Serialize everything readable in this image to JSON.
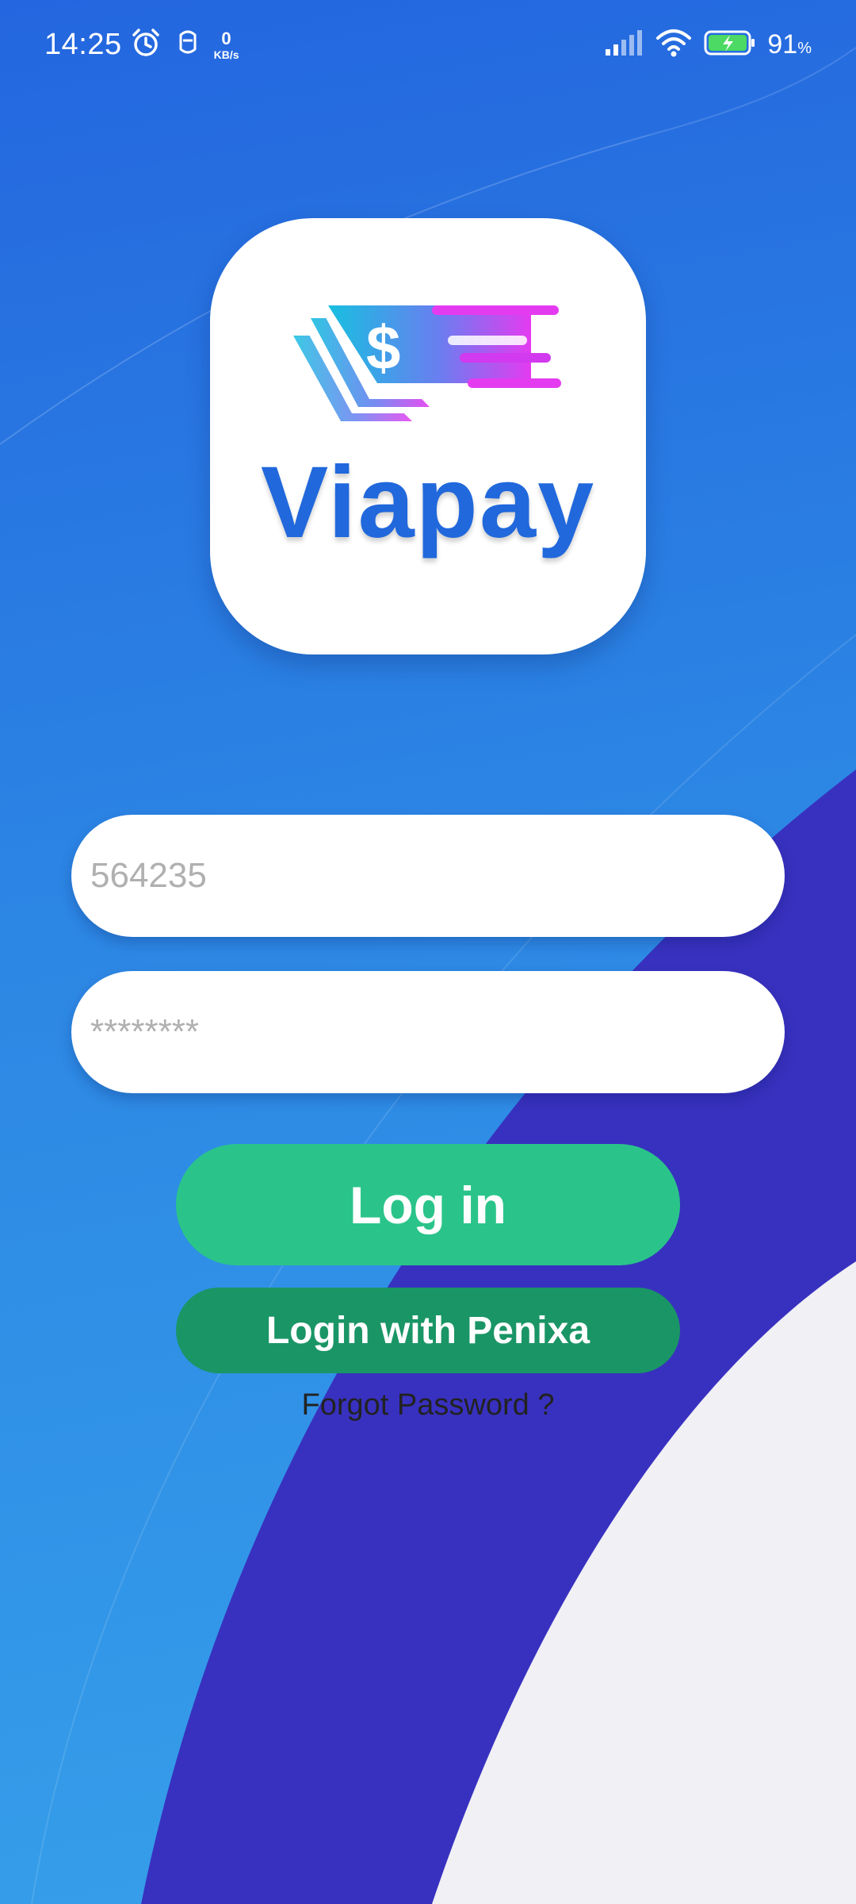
{
  "status_bar": {
    "time": "14:25",
    "net_speed_value": "0",
    "net_speed_unit": "KB/s",
    "battery_percent": "91",
    "battery_percent_sign": "%",
    "icons": [
      "alarm-icon",
      "face-icon",
      "signal-icon",
      "wifi-icon",
      "battery-charging-icon"
    ]
  },
  "logo": {
    "wordmark": "Viapay",
    "currency_symbol": "$"
  },
  "form": {
    "username_placeholder": "564235",
    "password_placeholder": "********"
  },
  "actions": {
    "login_label": "Log in",
    "penixa_label": "Login with Penixa",
    "forgot_label": "Forgot Password ?"
  },
  "colors": {
    "primary_blue": "#2168dc",
    "login_green": "#2ac48a",
    "penixa_green": "#1a9566",
    "swoosh_indigo": "#3831bf",
    "corner_gray": "#f0f0f5"
  }
}
